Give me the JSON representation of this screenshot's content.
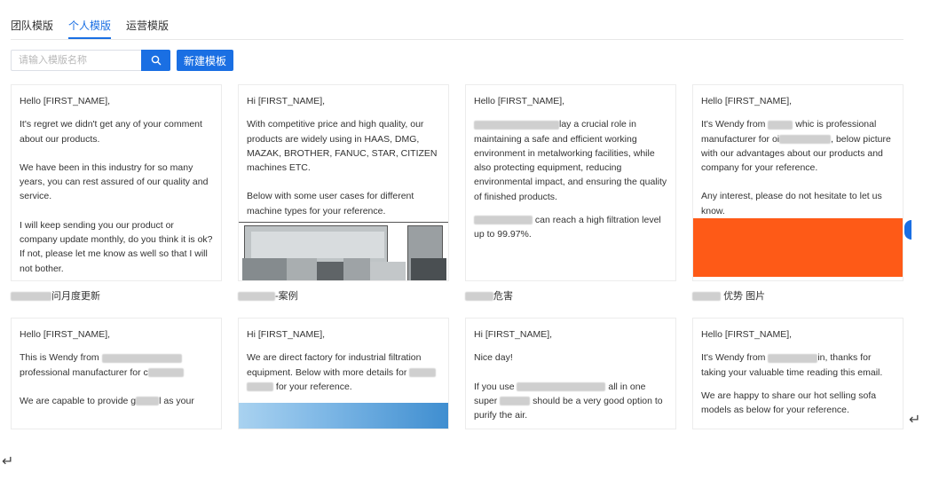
{
  "tabs": [
    {
      "label": "团队模版",
      "active": false
    },
    {
      "label": "个人模版",
      "active": true
    },
    {
      "label": "运营模版",
      "active": false
    }
  ],
  "search": {
    "placeholder": "请输入模版名称",
    "value": "",
    "icon": "search-icon"
  },
  "new_template_label": "新建模板",
  "colors": {
    "accent": "#1a6fe3",
    "orange_banner": "#fe5a17"
  },
  "cards_row1": [
    {
      "greeting": "Hello [FIRST_NAME],",
      "para1": "It's regret we didn't get any of your comment about our products.",
      "para2": "We have been in this industry for so many years, you can rest assured of our quality and service.",
      "para3": "I will keep sending you our product or company update monthly, do you think it is ok? If not, please let me know as well so that I will not bother.",
      "name": "问月度更新"
    },
    {
      "greeting": "Hi [FIRST_NAME],",
      "para1": "With competitive price and high quality, our products are widely using in HAAS, DMG, MAZAK, BROTHER, FANUC, STAR, CITIZEN machines ETC.",
      "para2": "Below with some user cases for different machine types for your reference.",
      "name": "-案例"
    },
    {
      "greeting": "Hello [FIRST_NAME],",
      "para1_tail": "lay a crucial role in maintaining a safe and efficient working environment in metalworking facilities, while also protecting equipment, reducing environmental impact, and ensuring the quality of finished products.",
      "para2_tail": "can reach a high filtration level up to 99.97%.",
      "name": "危害"
    },
    {
      "greeting": "Hello [FIRST_NAME],",
      "para1_a": "It's Wendy from",
      "para1_b": "whic is professional manufacturer for oi",
      "para1_c": ", below picture with our advantages about our products and company for your reference.",
      "para2": "Any interest, please do not hesitate to let us know.",
      "name": "优势 图片"
    }
  ],
  "cards_row2": [
    {
      "greeting": "Hello [FIRST_NAME],",
      "para1_a": "This is Wendy from",
      "para1_b": "professional manufacturer for c",
      "para2_a": "We are capable to provide g",
      "para2_b": "l as your"
    },
    {
      "greeting": "Hi [FIRST_NAME],",
      "para1_a": "We are direct factory for industrial filtration equipment. Below with more details for",
      "para1_b": "for your reference."
    },
    {
      "greeting": "Hi [FIRST_NAME],",
      "para1": "Nice day!",
      "para2_a": "If you use",
      "para2_b": "all in one super",
      "para2_c": "should be a very good option to purify the air."
    },
    {
      "greeting": "Hello [FIRST_NAME],",
      "para1_a": "It's Wendy from",
      "para1_b": "in, thanks for taking your valuable time reading this email.",
      "para2": "We are happy to share our hot selling sofa models as below for your reference."
    }
  ],
  "return_glyph": "↵"
}
